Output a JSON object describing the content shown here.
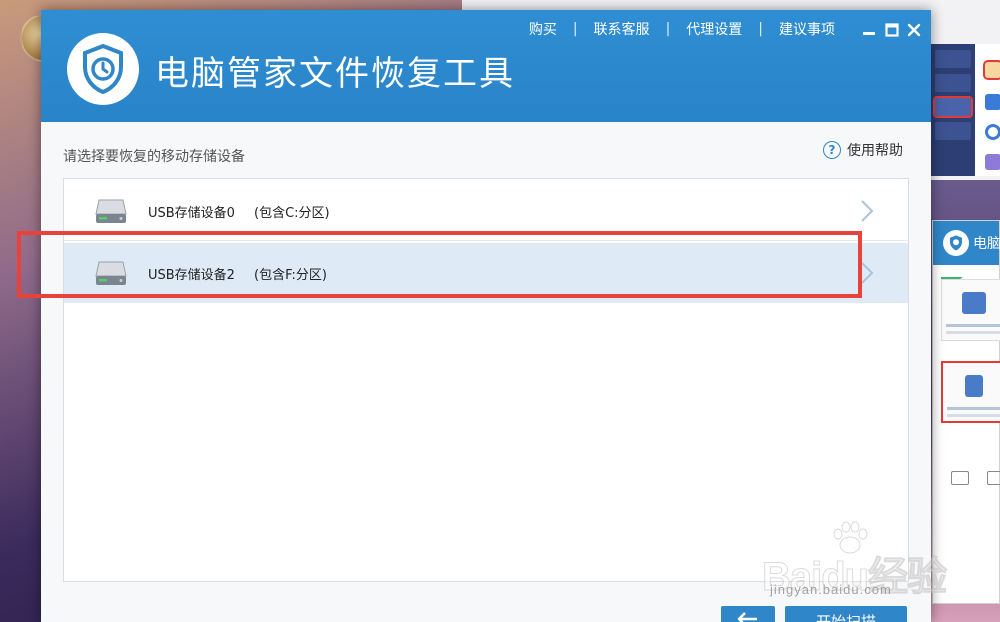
{
  "app": {
    "title": "电脑管家文件恢复工具"
  },
  "topnav": {
    "items": [
      {
        "label": "购买"
      },
      {
        "label": "联系客服"
      },
      {
        "label": "代理设置"
      },
      {
        "label": "建议事项"
      }
    ]
  },
  "content": {
    "prompt": "请选择要恢复的移动存储设备",
    "help_label": "使用帮助",
    "help_glyph": "?"
  },
  "devices": [
    {
      "name": "USB存储设备0",
      "partition": "(包含C:分区)",
      "selected": false
    },
    {
      "name": "USB存储设备2",
      "partition": "(包含F:分区)",
      "selected": true
    }
  ],
  "buttons": {
    "start_label": "开始扫描"
  },
  "background": {
    "win3_title": "电脑管"
  },
  "watermark": {
    "text": "Baidu经验",
    "url": "jingyan.baidu.com"
  },
  "colors": {
    "brand_blue": "#2f86c8",
    "selected_row": "#deebf7",
    "highlight_red": "#e8423a"
  },
  "icons": {
    "logo": "shield-clock-icon",
    "device": "hard-drive-icon",
    "row_arrow": "chevron-right-icon",
    "help": "question-circle-icon",
    "back": "back-arrow-icon",
    "minimize": "minimize-icon",
    "maximize": "maximize-icon",
    "close": "close-icon"
  }
}
